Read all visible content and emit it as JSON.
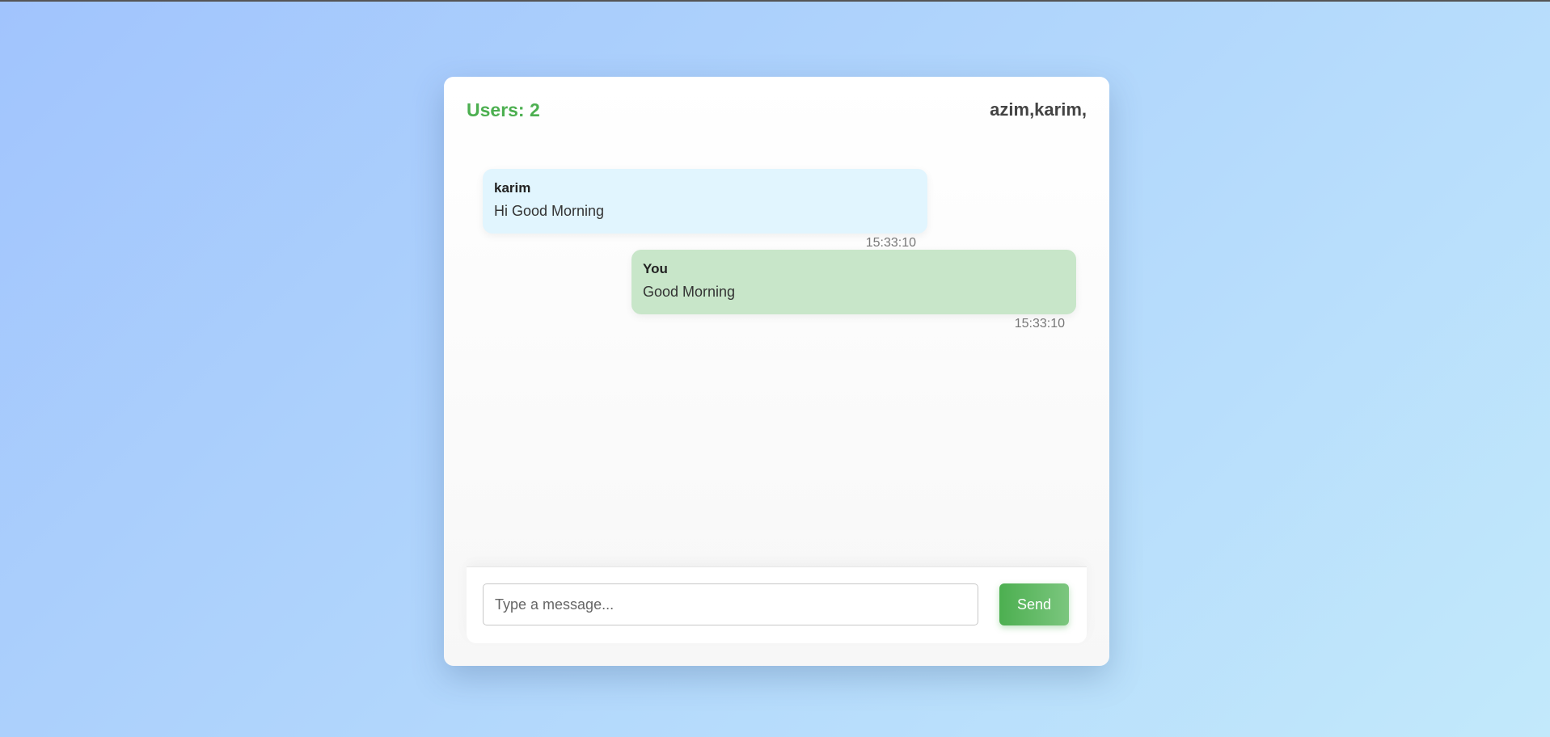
{
  "header": {
    "user_count": "Users: 2",
    "user_list": "azim,karim,"
  },
  "messages": [
    {
      "sender": "karim",
      "text": "Hi Good Morning",
      "time": "15:33:10",
      "direction": "incoming"
    },
    {
      "sender": "You",
      "text": "Good Morning",
      "time": "15:33:10",
      "direction": "outgoing"
    }
  ],
  "composer": {
    "placeholder": "Type a message...",
    "value": "",
    "send_label": "Send"
  },
  "colors": {
    "accent": "#4caf50",
    "incoming_bubble": "#e1f5fe",
    "outgoing_bubble": "#c8e6c9"
  }
}
